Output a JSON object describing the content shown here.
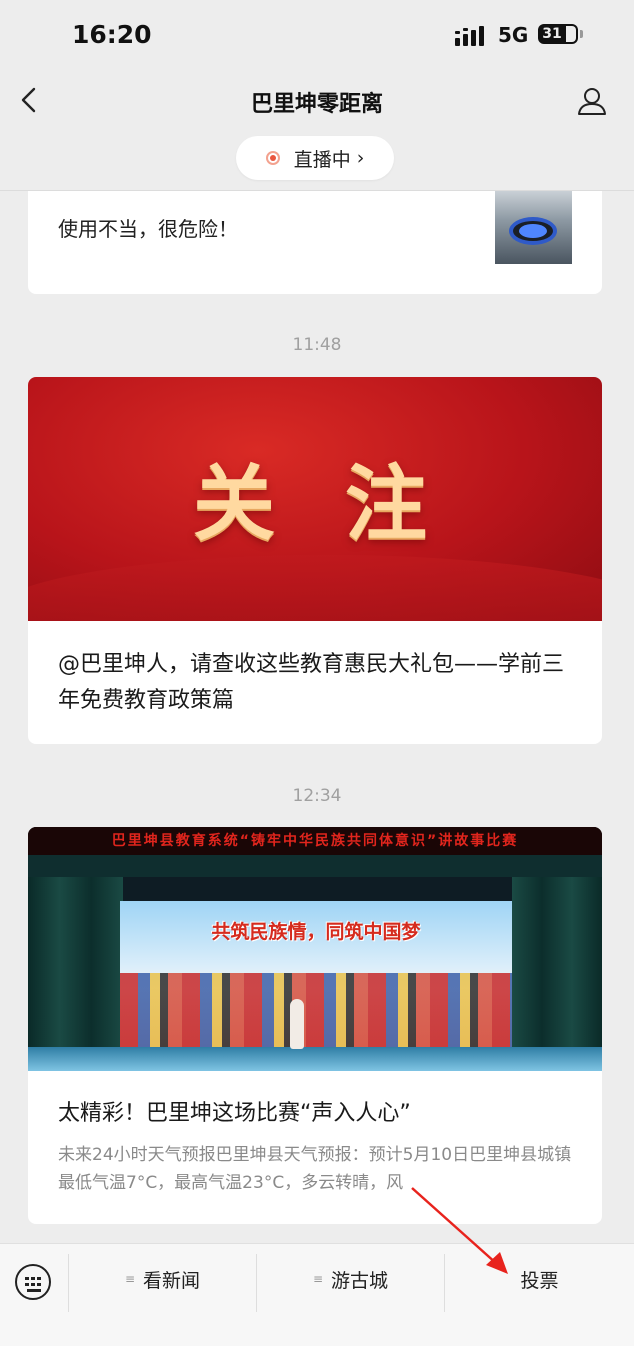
{
  "status_bar": {
    "time": "16:20",
    "network": "5G",
    "battery": "31"
  },
  "nav": {
    "title": "巴里坤零距离",
    "live_label": "直播中",
    "live_chevron": "›"
  },
  "feed": {
    "card1": {
      "text": "使用不当，很危险！"
    },
    "timestamp1": "11:48",
    "card2": {
      "banner_text": "关注",
      "title": "@巴里坤人，请查收这些教育惠民大礼包——学前三年免费教育政策篇"
    },
    "timestamp2": "12:34",
    "card3": {
      "marquee": "巴里坤县教育系统“铸牢中华民族共同体意识”讲故事比赛",
      "screen_text": "共筑民族情，同筑中国梦",
      "title": "太精彩！巴里坤这场比赛“声入人心”",
      "desc": "未来24小时天气预报巴里坤县天气预报：预计5月10日巴里坤县城镇最低气温7°C，最高气温23°C，多云转晴，风"
    }
  },
  "bottom_menu": {
    "items": [
      {
        "label": "看新闻",
        "glyph": "≡"
      },
      {
        "label": "游古城",
        "glyph": "≡"
      },
      {
        "label": "投票",
        "glyph": ""
      }
    ]
  },
  "colors": {
    "accent_red": "#e0251d",
    "background": "#ededed",
    "banner_gold": "#ffd9a0"
  }
}
